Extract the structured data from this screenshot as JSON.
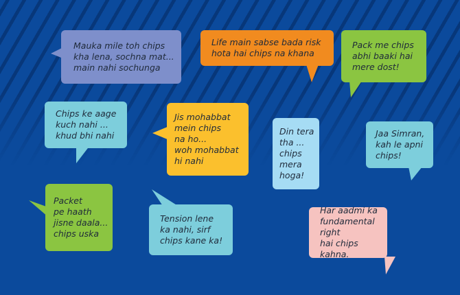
{
  "colors": {
    "background": "#0b4a9c",
    "stripe": "#06285f",
    "bubble_blue": "#7e8fcb",
    "bubble_orange": "#f18b1f",
    "bubble_green": "#8bc541",
    "bubble_teal": "#7dcedc",
    "bubble_yellow": "#fbc02d",
    "bubble_lightblue": "#a6dcf4",
    "bubble_pink": "#f6c3c0"
  },
  "quotes": [
    {
      "text": "Mauka mile toh chips\nkha lena, sochna mat...\nmain nahi sochunga"
    },
    {
      "text": "Life main sabse bada risk\nhota hai chips na khana"
    },
    {
      "text": "Pack me chips\nabhi baaki hai\nmere dost!"
    },
    {
      "text": "Chips ke aage\nkuch nahi ...\nkhud bhi nahi"
    },
    {
      "text": "Jis mohabbat\nmein chips\nna ho...\nwoh mohabbat\nhi nahi"
    },
    {
      "text": "Din tera\ntha ...\nchips\nmera\nhoga!"
    },
    {
      "text": "Jaa Simran,\nkah le apni\nchips!"
    },
    {
      "text": "Packet\npe haath\njisne daala...\nchips uska"
    },
    {
      "text": "Tension lene\nka nahi, sirf\nchips kane ka!"
    },
    {
      "text": "Har aadmi ka\nfundamental right\nhai chips kahna."
    }
  ]
}
